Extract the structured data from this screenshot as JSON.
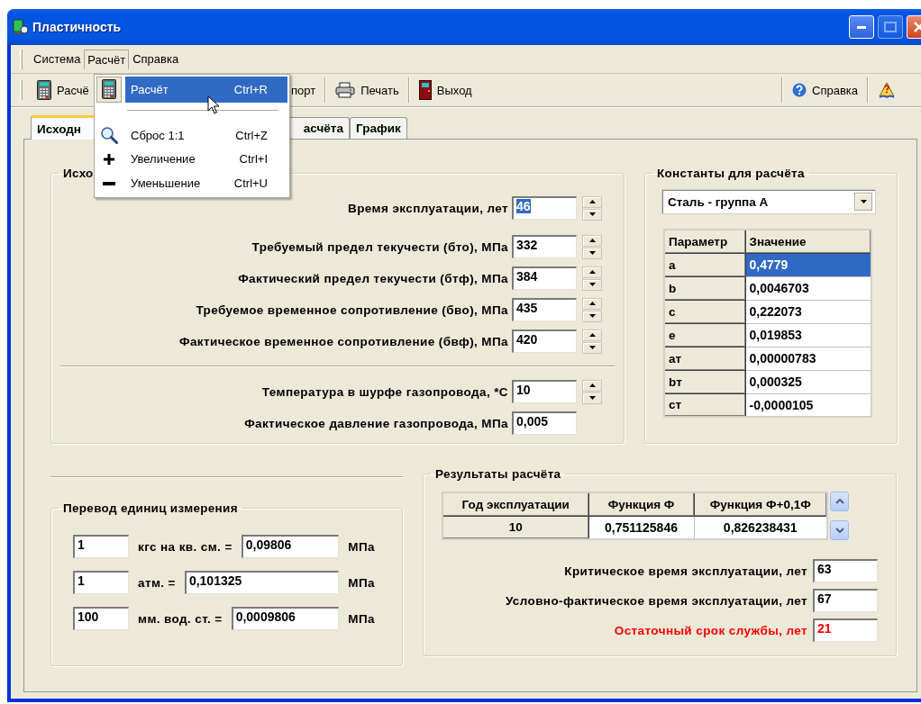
{
  "window": {
    "title": "Пластичность"
  },
  "menu_bar": [
    {
      "label": "Система",
      "selected": false
    },
    {
      "label": "Расчёт",
      "selected": true
    },
    {
      "label": "Справка",
      "selected": false
    }
  ],
  "toolbar": {
    "left": [
      {
        "label": "Расчё"
      },
      {
        "label": "порт"
      },
      {
        "label": "Печать"
      },
      {
        "label": "Выход"
      }
    ],
    "right": [
      {
        "kind": "labeled",
        "label": "Справка"
      },
      {
        "kind": "icon"
      }
    ]
  },
  "dropdown": {
    "items": [
      {
        "kind": "command",
        "label": "Расчёт",
        "shortcut": "Ctrl+R",
        "selected": true
      },
      {
        "kind": "separator"
      },
      {
        "kind": "command",
        "label": "Сброс 1:1",
        "shortcut": "Ctrl+Z",
        "selected": false
      },
      {
        "kind": "command",
        "label": "Увеличение",
        "shortcut": "Ctrl+I",
        "selected": false
      },
      {
        "kind": "command",
        "label": "Уменьшение",
        "shortcut": "Ctrl+U",
        "selected": false
      }
    ]
  },
  "tabs": [
    {
      "label": "Исходн",
      "selected": true
    },
    {
      "label": "асчёта",
      "selected": false
    },
    {
      "label": "График",
      "selected": false
    }
  ],
  "source_group": {
    "title": "Исхо",
    "rows": [
      {
        "label": "Время эксплуатации, лет",
        "value": "46",
        "spinner": true,
        "text_selected": true,
        "divider_before": false
      },
      {
        "label": "Требуемый предел текучести (бто), МПа",
        "value": "332",
        "spinner": true,
        "text_selected": false,
        "divider_before": false
      },
      {
        "label": "Фактический предел текучести (бтф), МПа",
        "value": "384",
        "spinner": true,
        "text_selected": false,
        "divider_before": false
      },
      {
        "label": "Требуемое временное сопротивление (бво), МПа",
        "value": "435",
        "spinner": true,
        "text_selected": false,
        "divider_before": false
      },
      {
        "label": "Фактическое временное сопротивление (бвф), МПа",
        "value": "420",
        "spinner": true,
        "text_selected": false,
        "divider_before": false
      },
      {
        "label": "Температура в шурфе газопровода, *С",
        "value": "10",
        "spinner": true,
        "text_selected": false,
        "divider_before": true
      },
      {
        "label": "Фактическое давление газопровода, МПа",
        "value": "0,005",
        "spinner": false,
        "text_selected": false,
        "divider_before": false
      }
    ]
  },
  "constants": {
    "title": "Константы для расчёта",
    "material": "Сталь - группа А",
    "columns": [
      "Параметр",
      "Значение"
    ],
    "rows": [
      {
        "param": "a",
        "value": "0,4779",
        "selected": true
      },
      {
        "param": "b",
        "value": "0,0046703",
        "selected": false
      },
      {
        "param": "c",
        "value": "0,222073",
        "selected": false
      },
      {
        "param": "e",
        "value": "0,019853",
        "selected": false
      },
      {
        "param": "aт",
        "value": "0,00000783",
        "selected": false
      },
      {
        "param": "bт",
        "value": "0,000325",
        "selected": false
      },
      {
        "param": "cт",
        "value": "-0,0000105",
        "selected": false
      }
    ]
  },
  "conversion": {
    "title": "Перевод единиц измерения",
    "rows": [
      {
        "amount": "1",
        "unit": "кгс на кв. см. =",
        "result": "0,09806",
        "result_unit": "МПа"
      },
      {
        "amount": "1",
        "unit": "атм. =",
        "result": "0,101325",
        "result_unit": "МПа"
      },
      {
        "amount": "100",
        "unit": "мм. вод. ст. =",
        "result": "0,0009806",
        "result_unit": "МПа"
      }
    ]
  },
  "results": {
    "title": "Результаты расчёта",
    "columns": [
      "Год эксплуатации",
      "Функция Ф",
      "Функция Ф+0,1Ф"
    ],
    "rows": [
      [
        "10",
        "0,751125846",
        "0,826238431"
      ]
    ],
    "fields": [
      {
        "label": "Критическое время эксплуатации, лет",
        "value": "63",
        "alert": false
      },
      {
        "label": "Условно-фактическое время эксплуатации, лет",
        "value": "67",
        "alert": false
      },
      {
        "label": "Остаточный срок службы, лет",
        "value": "21",
        "alert": true
      }
    ]
  }
}
